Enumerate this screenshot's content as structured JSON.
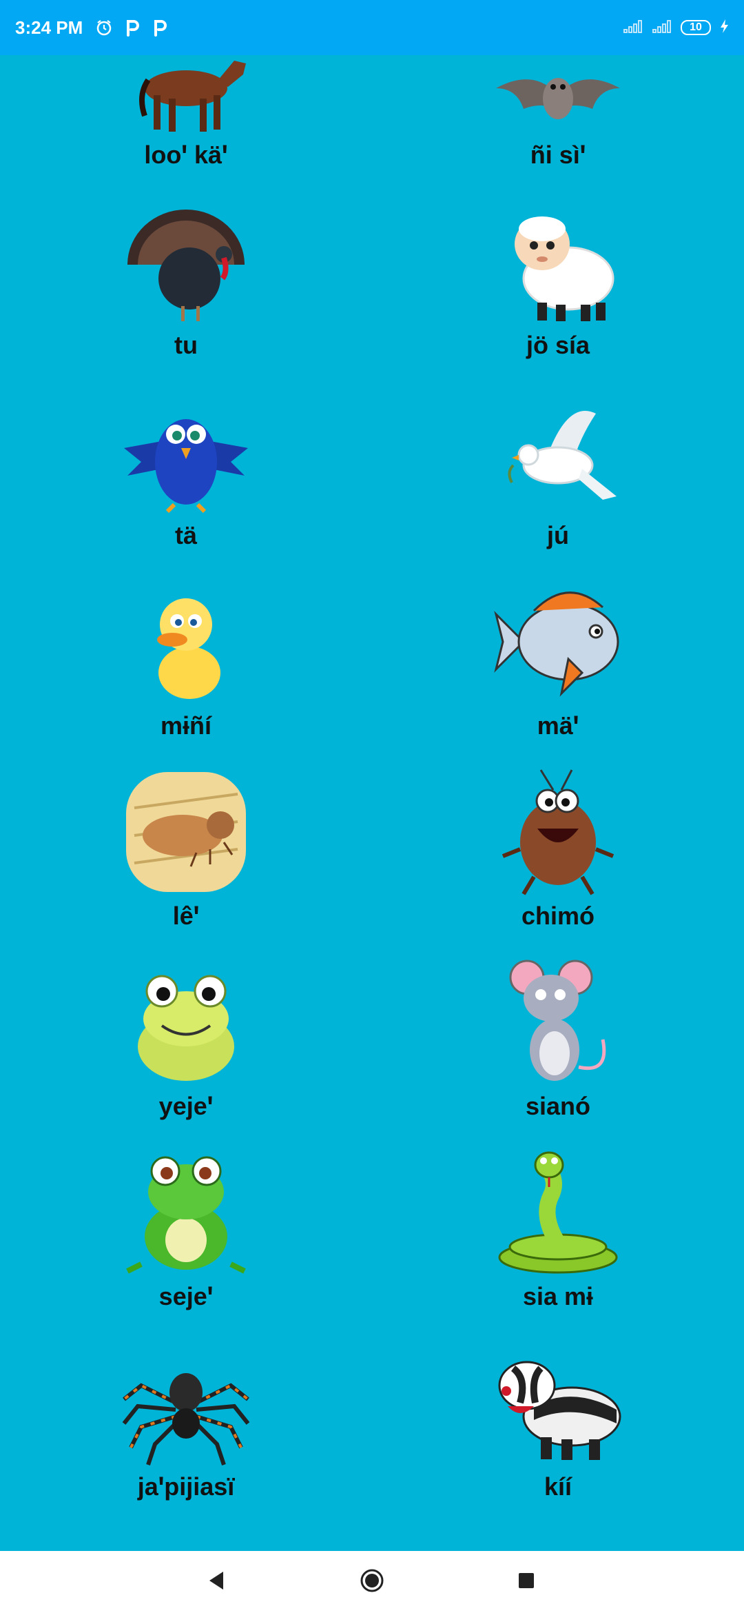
{
  "status_bar": {
    "time": "3:24 PM",
    "icons_left": [
      "alarm-icon",
      "p-app-icon",
      "p-app-icon"
    ],
    "battery_level": "10",
    "icons_right": [
      "signal-icon",
      "signal-icon",
      "battery-icon",
      "charging-icon"
    ]
  },
  "colors": {
    "status_bar_bg": "#02a8f4",
    "content_bg": "#00b4d8",
    "nav_bg": "#ffffff"
  },
  "animals": [
    {
      "label": "looꞌ käꞌ",
      "icon": "horse-icon"
    },
    {
      "label": "ñi sìꞌ",
      "icon": "bat-icon"
    },
    {
      "label": "tu",
      "icon": "turkey-icon"
    },
    {
      "label": "jö sía",
      "icon": "sheep-icon"
    },
    {
      "label": "tä",
      "icon": "blue-bird-icon"
    },
    {
      "label": "jú",
      "icon": "dove-icon"
    },
    {
      "label": "mɨñí",
      "icon": "duckling-icon"
    },
    {
      "label": "mäꞌ",
      "icon": "fish-icon"
    },
    {
      "label": "lêꞌ",
      "icon": "larva-icon"
    },
    {
      "label": "chimó",
      "icon": "cockroach-icon"
    },
    {
      "label": "yejeꞌ",
      "icon": "frog-icon"
    },
    {
      "label": "sianó",
      "icon": "mouse-icon"
    },
    {
      "label": "sejeꞌ",
      "icon": "toad-icon"
    },
    {
      "label": "sia mɨ",
      "icon": "snake-icon"
    },
    {
      "label": "jaꞌpijiasï",
      "icon": "spider-icon"
    },
    {
      "label": "kíí",
      "icon": "badger-icon"
    }
  ],
  "nav": {
    "back": "back-icon",
    "home": "home-icon",
    "recents": "recents-icon"
  }
}
